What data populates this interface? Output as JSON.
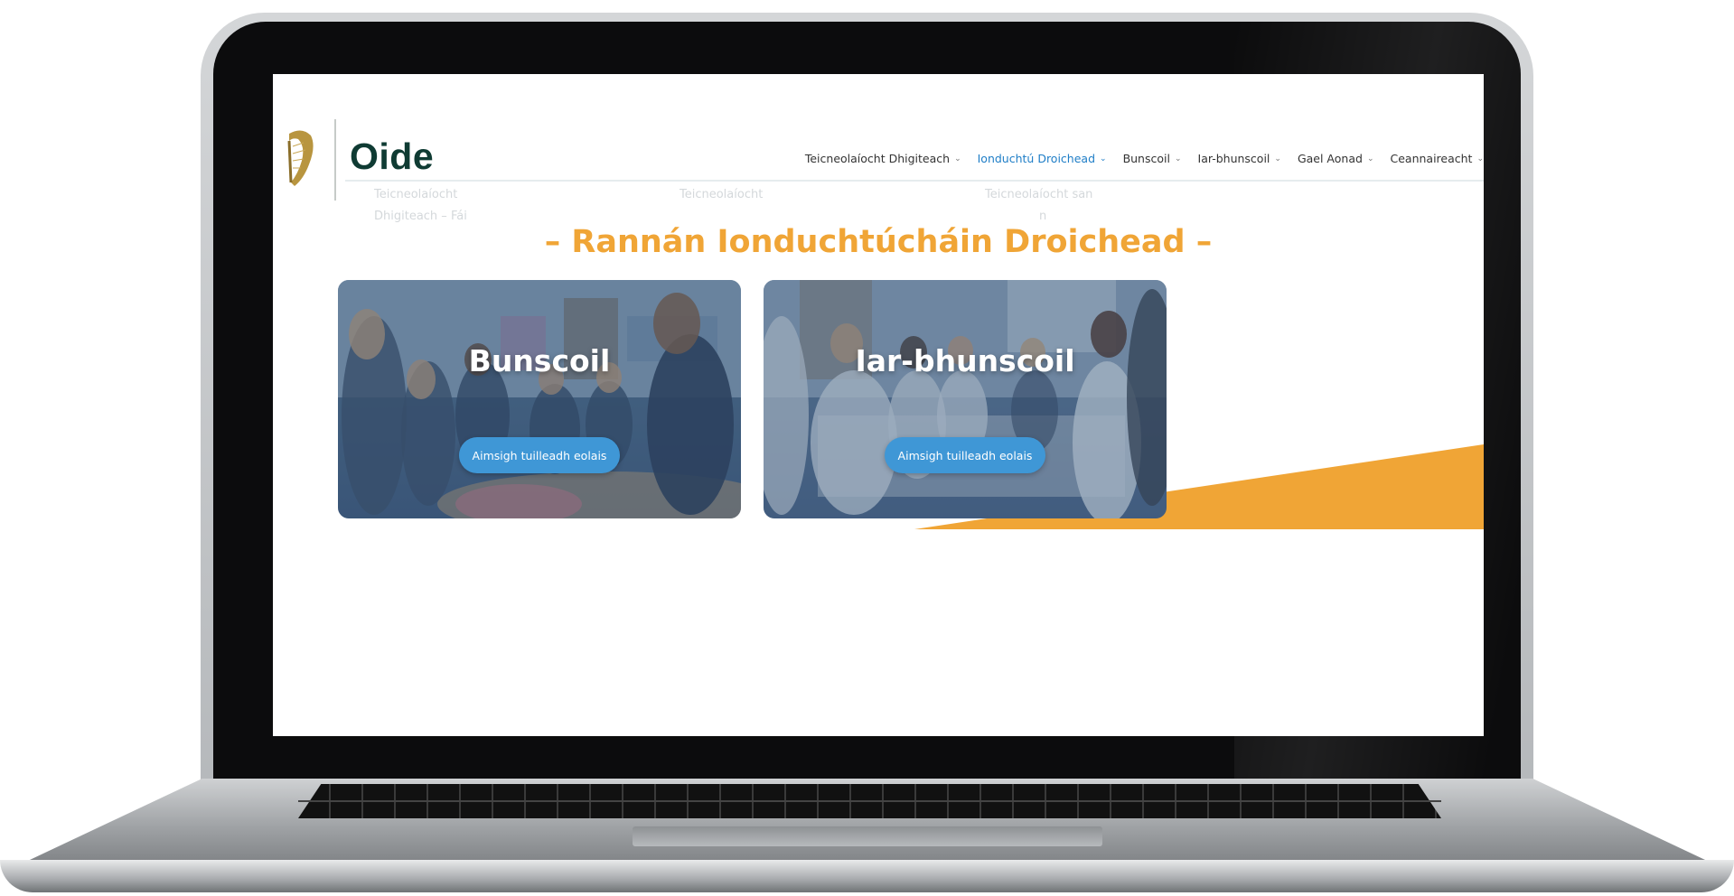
{
  "site": {
    "logo_text": "Oide"
  },
  "nav": {
    "items": [
      {
        "label": "Teicneolaíocht Dhigiteach",
        "active": false
      },
      {
        "label": "Ionduchtú Droichead",
        "active": true
      },
      {
        "label": "Bunscoil",
        "active": false
      },
      {
        "label": "Iar-bhunscoil",
        "active": false
      },
      {
        "label": "Gael Aonad",
        "active": false
      },
      {
        "label": "Ceannaireacht",
        "active": false
      }
    ],
    "chevron": "⌄"
  },
  "ghost_menu": {
    "col1_line1": "Teicneolaíocht",
    "col1_line2": "Dhigiteach – Fái",
    "col2_line1": "Teicneolaíocht",
    "col3_line1": "Teicneolaíocht san",
    "col3_line2": "n"
  },
  "main": {
    "heading": "– Rannán Ionduchtúcháin Droichead –",
    "cards": [
      {
        "title": "Bunscoil",
        "button": "Aimsigh tuilleadh eolais"
      },
      {
        "title": "Iar-bhunscoil",
        "button": "Aimsigh tuilleadh eolais"
      }
    ]
  },
  "colors": {
    "accent_orange": "#f0a536",
    "button_blue": "#3f97d6",
    "active_nav": "#1f7ec7",
    "logo_green": "#0f3b33"
  },
  "icons": {
    "logo": "harp-icon",
    "nav_dropdown": "chevron-down-icon"
  }
}
